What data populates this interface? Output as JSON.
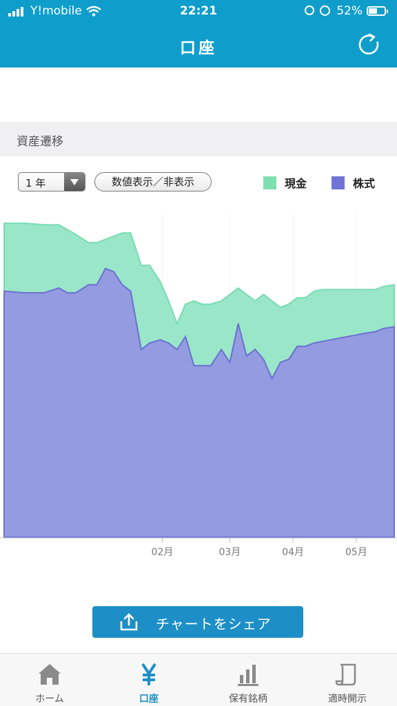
{
  "status_bar": {
    "carrier": "Y!mobile",
    "time": "22:21",
    "battery": "52%"
  },
  "header": {
    "title": "口座"
  },
  "section": {
    "title": "資産遷移"
  },
  "controls": {
    "period": "1 年",
    "toggle_values": "数値表示／非表示"
  },
  "legend": [
    {
      "label": "現金",
      "color": "#7ee0b0"
    },
    {
      "label": "株式",
      "color": "#6f74d6"
    }
  ],
  "chart_data": {
    "type": "area",
    "stacked": true,
    "x_tick_labels": [
      "02月",
      "03月",
      "04月",
      "05月"
    ],
    "x_tick_positions": [
      0.25,
      0.57,
      0.87,
      1.17
    ],
    "x_range": [
      -0.5,
      1.35
    ],
    "y_range": [
      0,
      100
    ],
    "x": [
      -0.5,
      -0.4,
      -0.31,
      -0.24,
      -0.2,
      -0.16,
      -0.1,
      -0.06,
      -0.02,
      0.02,
      0.06,
      0.1,
      0.15,
      0.19,
      0.24,
      0.28,
      0.32,
      0.36,
      0.4,
      0.44,
      0.48,
      0.53,
      0.57,
      0.61,
      0.65,
      0.69,
      0.73,
      0.77,
      0.81,
      0.85,
      0.89,
      0.93,
      0.97,
      1.01,
      1.05,
      1.09,
      1.13,
      1.17,
      1.21,
      1.26,
      1.3,
      1.35
    ],
    "series": [
      {
        "name": "株式",
        "values": [
          76,
          75.5,
          75.5,
          77,
          75.5,
          75.5,
          78,
          78,
          83,
          82,
          78,
          76,
          58,
          60,
          61,
          60,
          58,
          62,
          53,
          53,
          53,
          58,
          54,
          66,
          56,
          58,
          55,
          49,
          54,
          55,
          59,
          59,
          60,
          60.5,
          61,
          61.5,
          62,
          62.5,
          63,
          63.5,
          64.5,
          65
        ]
      },
      {
        "name": "現金",
        "values": [
          21,
          21.5,
          21,
          19.5,
          19.5,
          18,
          13,
          13,
          9,
          11,
          16,
          18,
          26,
          24,
          18,
          13,
          8,
          10,
          20,
          19,
          19,
          15,
          21,
          11,
          19,
          15,
          20,
          24,
          17,
          17,
          15,
          15,
          16,
          16,
          15.5,
          15,
          14.5,
          14,
          13.5,
          13,
          13,
          13
        ]
      }
    ]
  },
  "share": {
    "label": "チャートをシェア"
  },
  "tabs": [
    {
      "label": "ホーム",
      "icon": "home-icon",
      "active": false
    },
    {
      "label": "口座",
      "icon": "yen-icon",
      "active": true
    },
    {
      "label": "保有銘柄",
      "icon": "bar-chart-icon",
      "active": false
    },
    {
      "label": "適時開示",
      "icon": "document-icon",
      "active": false
    }
  ]
}
